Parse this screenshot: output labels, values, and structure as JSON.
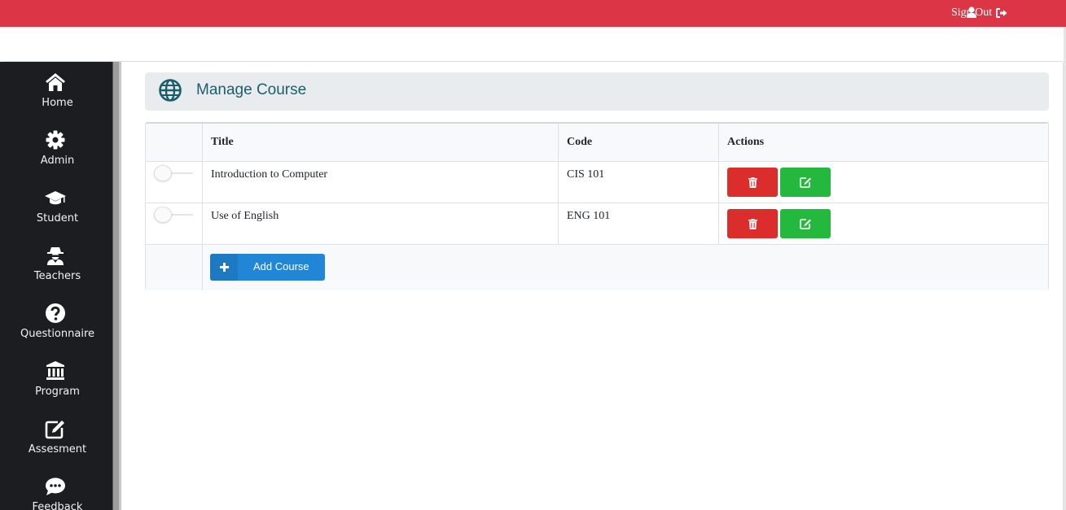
{
  "topbar": {
    "signout_label": "Sign Out",
    "color": "#dc3545"
  },
  "sidebar": {
    "items": [
      {
        "label": "Home",
        "icon": "home-icon"
      },
      {
        "label": "Admin",
        "icon": "gear-icon"
      },
      {
        "label": "Student",
        "icon": "graduation-cap-icon"
      },
      {
        "label": "Teachers",
        "icon": "user-secret-icon"
      },
      {
        "label": "Questionnaire",
        "icon": "question-circle-icon"
      },
      {
        "label": "Program",
        "icon": "institution-icon"
      },
      {
        "label": "Assesment",
        "icon": "edit-icon"
      },
      {
        "label": "Feedback",
        "icon": "comment-dots-icon"
      }
    ]
  },
  "header": {
    "title": "Manage Course",
    "icon": "globe-icon"
  },
  "table": {
    "headers": [
      "Title",
      "Code",
      "Actions"
    ],
    "rows": [
      {
        "title": "Introduction to Computer",
        "code": "CIS 101",
        "enabled": false
      },
      {
        "title": "Use of English",
        "code": "ENG 101",
        "enabled": false
      }
    ],
    "add_label": "Add Course"
  },
  "colors": {
    "danger": "#dc2d2d",
    "success": "#24b83f",
    "primary": "#2186d5",
    "title": "#1b5e6b"
  }
}
